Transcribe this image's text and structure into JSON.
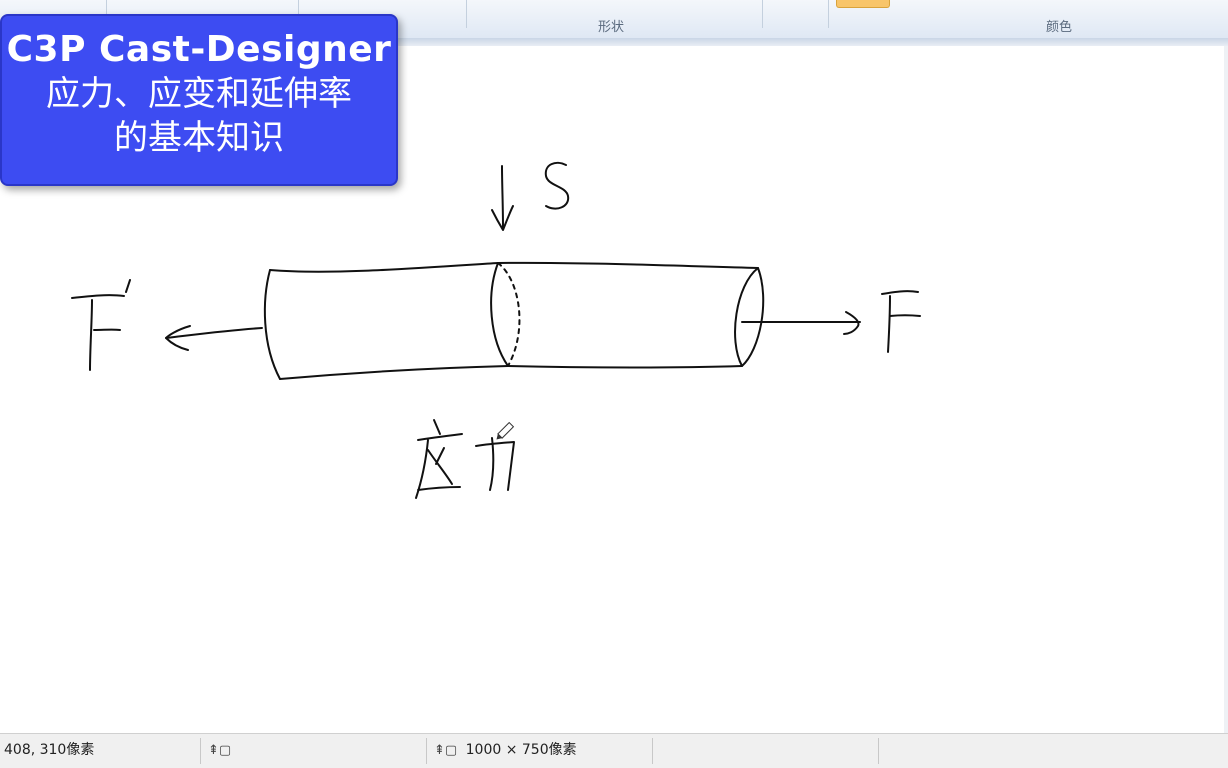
{
  "ribbon": {
    "groups": [
      {
        "label": "形状"
      },
      {
        "label": "颜色"
      }
    ],
    "accent_color": "#f8c56a"
  },
  "title_overlay": {
    "line1": "C3P Cast-Designer",
    "line2": "应力、应变和延伸率",
    "line3": "的基本知识",
    "background_color": "#3d4cf2"
  },
  "canvas": {
    "handwritten_labels": [
      {
        "text": "S",
        "role": "cross-section label"
      },
      {
        "text": "F'",
        "role": "left force label"
      },
      {
        "text": "F",
        "role": "right force label"
      },
      {
        "text": "应力",
        "role": "handwritten caption"
      }
    ],
    "cursor": "pencil-icon"
  },
  "statusbar": {
    "cursor_position": "408, 310像素",
    "selection_size": "",
    "image_size": "1000 × 750像素",
    "selection_icon": "selection-icon",
    "size_icon": "image-size-icon"
  }
}
